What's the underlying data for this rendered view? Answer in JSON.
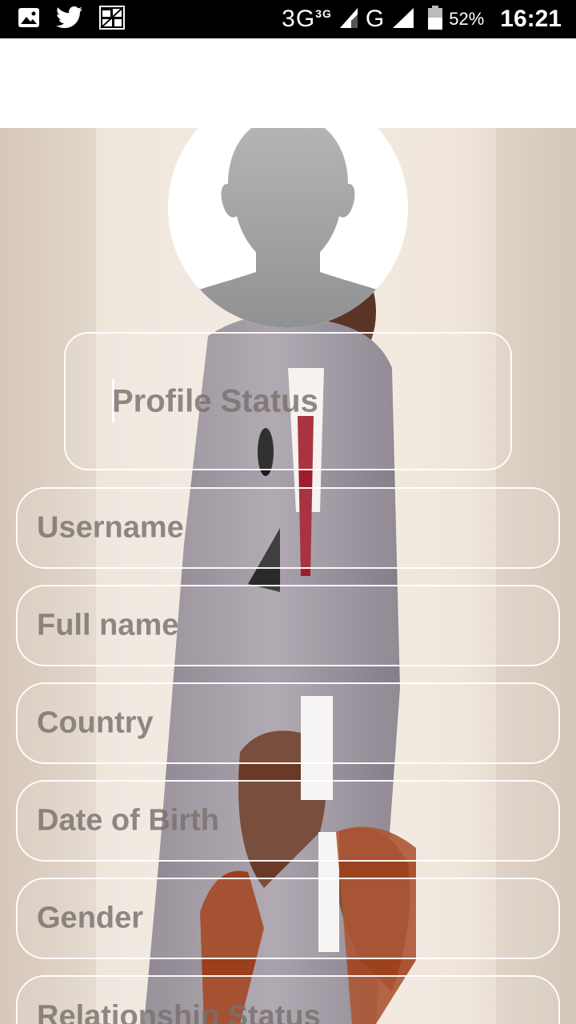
{
  "status_bar": {
    "network_primary": "3G",
    "network_primary_sup": "3G",
    "network_secondary": "G",
    "battery": "52%",
    "time": "16:21",
    "icons": [
      "image-icon",
      "twitter-icon",
      "app-icon",
      "signal-icon",
      "battery-icon"
    ]
  },
  "profile": {
    "avatar_icon": "person-silhouette-icon",
    "status_placeholder": "Profile Status"
  },
  "form": {
    "fields": [
      {
        "label": "Username"
      },
      {
        "label": "Full name"
      },
      {
        "label": "Country"
      },
      {
        "label": "Date of Birth"
      },
      {
        "label": "Gender"
      },
      {
        "label": "Relationship Status"
      }
    ]
  },
  "colors": {
    "status_bar_bg": "#000000",
    "field_border": "#ffffff",
    "placeholder_text": "#78706c"
  }
}
